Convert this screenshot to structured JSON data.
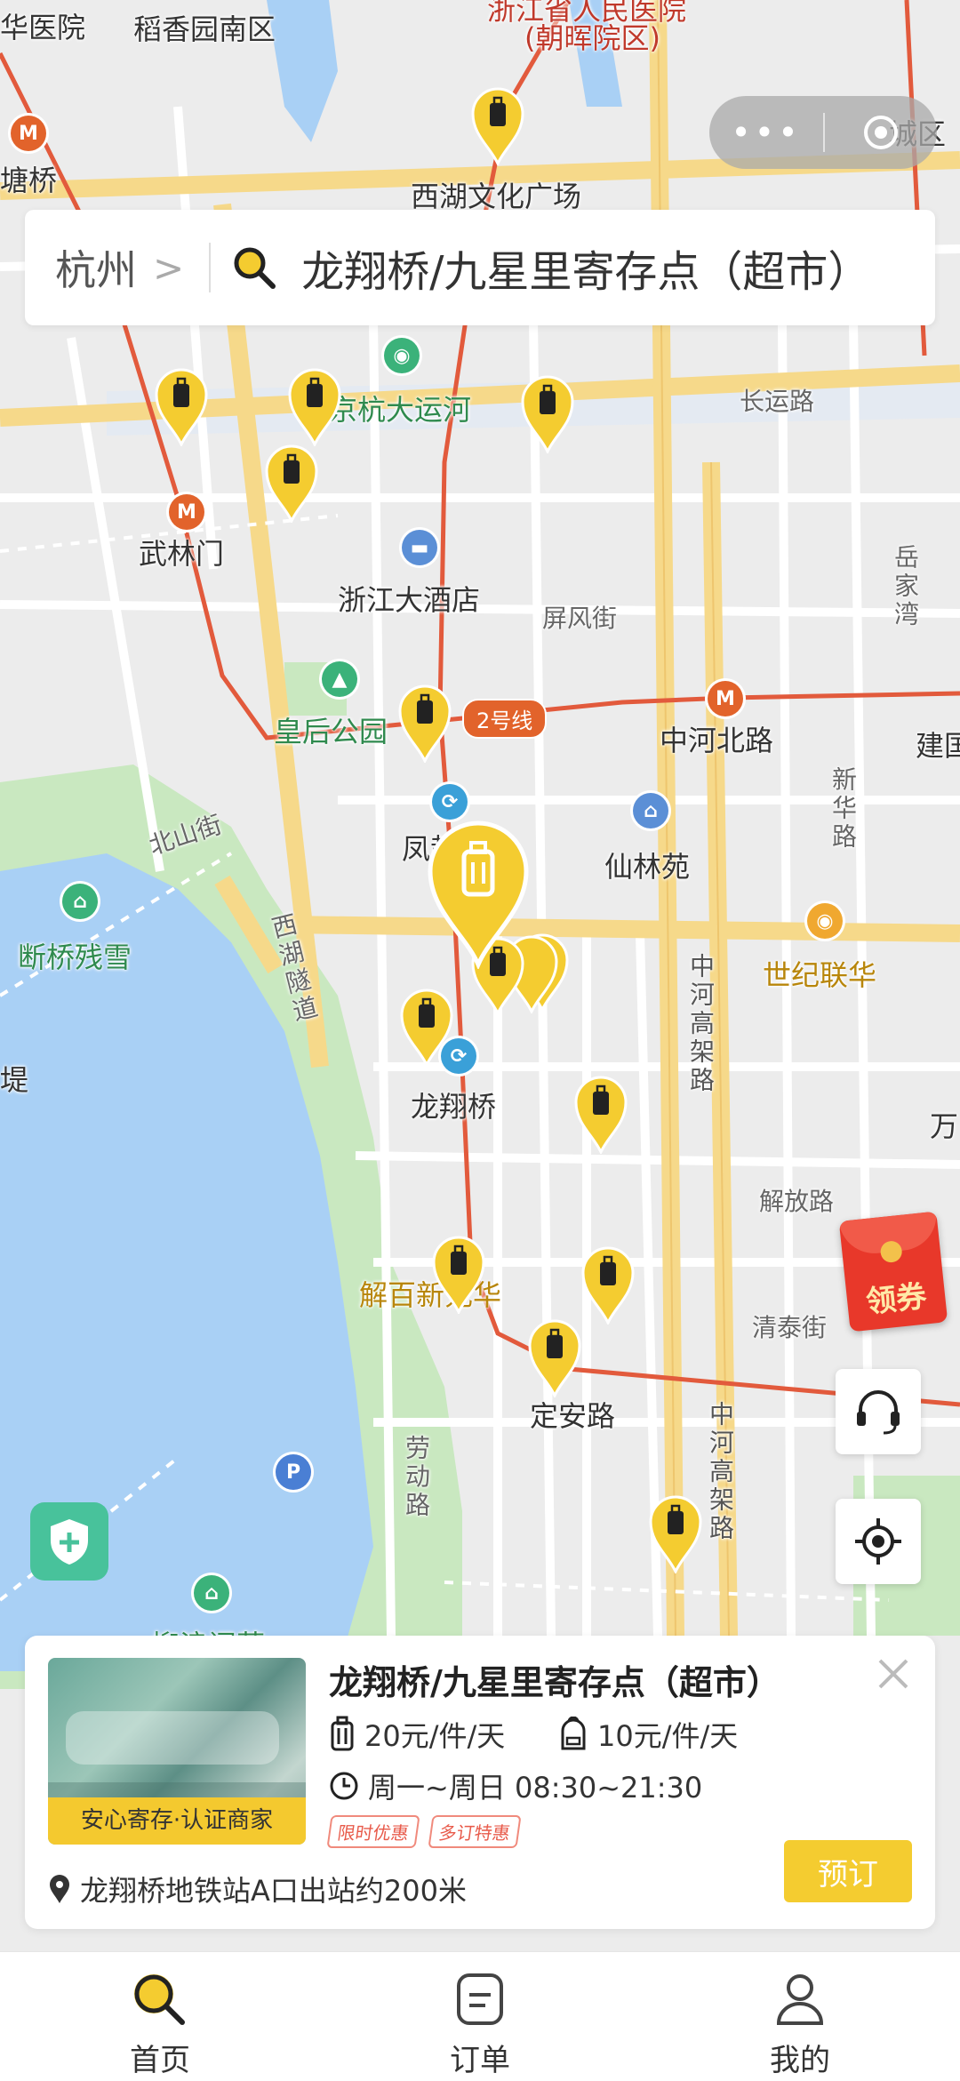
{
  "capsule": {
    "dots_icon": "more-dots-icon",
    "close_icon": "close-circle-icon"
  },
  "search": {
    "city": "杭州",
    "query": "龙翔桥/九星里寄存点（超市）"
  },
  "map": {
    "labels": [
      "华医院",
      "稻香园南区",
      "浙江省人民医院",
      "(朝晖院区)",
      "塘桥",
      "西湖文化广场",
      "城区",
      "京杭大运河",
      "长运路",
      "武林门",
      "浙江大酒店",
      "屏风街",
      "岳家湾",
      "皇后公园",
      "中河北路",
      "建国",
      "新华路",
      "凤起",
      "仙林苑",
      "北山街",
      "断桥残雪",
      "西湖隧道",
      "世纪联华",
      "中河高架路",
      "龙翔桥",
      "万",
      "解放路",
      "解百新元华",
      "清泰街",
      "定安路",
      "劳动路",
      "中河高架路",
      "堤",
      "柳浪闻莺"
    ],
    "metro_line": "2号线"
  },
  "buttons": {
    "coupon": "领券",
    "service_icon": "headset-icon",
    "locate_icon": "locate-icon",
    "shield_icon": "shield-icon"
  },
  "card": {
    "title": "龙翔桥/九星里寄存点（超市）",
    "badge": "安心寄存·认证商家",
    "price_large": "20元/件/天",
    "price_small": "10元/件/天",
    "hours": "周一~周日 08:30~21:30",
    "tags": [
      "限时优惠",
      "多订特惠"
    ],
    "location": "龙翔桥地铁站A口出站约200米",
    "book": "预订"
  },
  "tabs": [
    {
      "label": "首页",
      "icon": "search-icon"
    },
    {
      "label": "订单",
      "icon": "order-icon"
    },
    {
      "label": "我的",
      "icon": "user-icon"
    }
  ],
  "colors": {
    "accent": "#f4cc30",
    "metro": "#e2632b",
    "water": "#a9d0f5",
    "park": "#c9e8c0"
  }
}
